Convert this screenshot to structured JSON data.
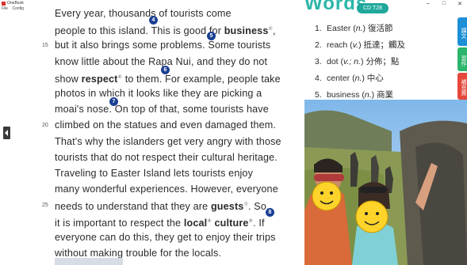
{
  "window": {
    "title": "OneBook",
    "menu": [
      "File",
      "Config"
    ],
    "controls": [
      "–",
      "□",
      "✕"
    ]
  },
  "passage": {
    "lines": [
      {
        "no": "",
        "text": "Every year, thousands of tourists come"
      },
      {
        "no": "",
        "pre": "people to this island. This is good for ",
        "bold": "business",
        "sup": "⑤",
        "post": ","
      },
      {
        "no": "15",
        "text": "but it also brings some problems. Some tourists"
      },
      {
        "no": "",
        "text": "know little about the Rapa Nui, and they do not"
      },
      {
        "no": "",
        "pre": "show ",
        "bold": "respect",
        "sup": "⑥",
        "post": " to them. For example, people take"
      },
      {
        "no": "",
        "text": "photos in which it looks like they are picking a"
      },
      {
        "no": "",
        "text": "moai's nose. On top of that, some tourists have"
      },
      {
        "no": "20",
        "text": "climbed on the statues and even damaged them."
      },
      {
        "no": "",
        "text": "That's why the islanders get very angry with those"
      },
      {
        "no": "",
        "text": "tourists that do not respect their cultural heritage."
      },
      {
        "no": "",
        "text": "      Traveling to Easter Island lets tourists enjoy"
      },
      {
        "no": "",
        "text": "many wonderful experiences. However, everyone"
      },
      {
        "no": "25",
        "pre": "needs to understand that they are ",
        "bold": "guests",
        "sup": "⑦",
        "post": ". So,"
      },
      {
        "no": "",
        "pre": "it is important to respect the ",
        "bold": "local",
        "sup": "⑧",
        "post": " ",
        "bold2": "culture",
        "sup2": "⑨",
        "post2": ". If"
      },
      {
        "no": "",
        "text": "everyone can do this, they get to enjoy their trips"
      },
      {
        "no": "",
        "text": "without making trouble for the locals."
      }
    ],
    "markers": [
      "4",
      "5",
      "6",
      "7",
      "8"
    ]
  },
  "vocab_header": {
    "title": "Words",
    "badge": "CD T28"
  },
  "vocab": [
    {
      "num": "1.",
      "word": "Easter",
      "pos": "n.",
      "meaning": "復活節"
    },
    {
      "num": "2.",
      "word": "reach",
      "pos": "v.",
      "meaning": "抵達；觸及"
    },
    {
      "num": "3.",
      "word": "dot",
      "pos": "v.; n.",
      "meaning": "分佈；點"
    },
    {
      "num": "4.",
      "word": "center",
      "pos": "n.",
      "meaning": "中心"
    },
    {
      "num": "5.",
      "word": "business",
      "pos": "n.",
      "meaning": "商業"
    }
  ],
  "side_tabs": [
    {
      "label": "課文",
      "color": "#1c8fd6"
    },
    {
      "label": "習作",
      "color": "#2bb56a"
    },
    {
      "label": "補充資",
      "color": "#e5473a"
    }
  ]
}
